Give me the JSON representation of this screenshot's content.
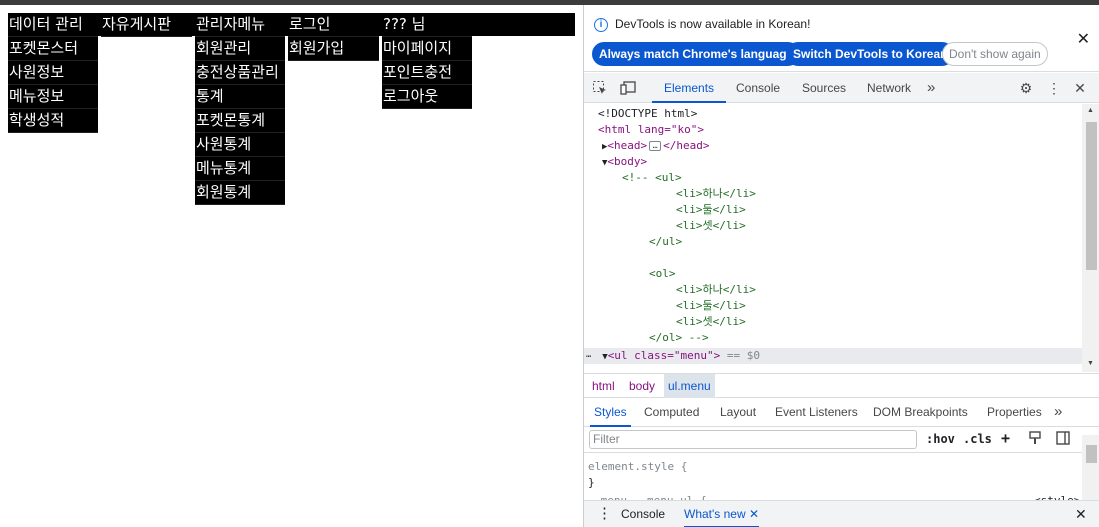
{
  "page": {
    "menu": [
      {
        "label": "데이터 관리",
        "items": [
          "포켓몬스터",
          "사원정보",
          "메뉴정보",
          "학생성적"
        ]
      },
      {
        "label": "자유게시판",
        "items": []
      },
      {
        "label": "관리자메뉴",
        "items": [
          "회원관리",
          "충전상품관리",
          "통계",
          "포켓몬통계",
          "사원통계",
          "메뉴통계",
          "회원통계"
        ]
      },
      {
        "label": "로그인",
        "items": [
          "회원가입"
        ]
      },
      {
        "label": "??? 님",
        "items": [
          "마이페이지",
          "포인트충전",
          "로그아웃"
        ]
      }
    ]
  },
  "devtools": {
    "info": {
      "icon": "info-icon",
      "message": "DevTools is now available in Korean!",
      "btn_match": "Always match Chrome's language",
      "btn_switch": "Switch DevTools to Korean",
      "btn_dont": "Don't show again",
      "close": "✕"
    },
    "tabs": {
      "elements": "Elements",
      "console": "Console",
      "sources": "Sources",
      "network": "Network",
      "more": "»"
    },
    "dom": [
      "<!DOCTYPE html>",
      "<html lang=\"ko\">",
      "<head>",
      "</head>",
      "<body>",
      "<!-- <ul>",
      "<li>하나</li>",
      "<li>둘</li>",
      "<li>셋</li>",
      "</ul>",
      "<ol>",
      "<li>하나</li>",
      "<li>둘</li>",
      "<li>셋</li>",
      "</ol> -->",
      "<ul class=\"menu\">",
      "== $0"
    ],
    "breadcrumbs": [
      "html",
      "body",
      "ul.menu"
    ],
    "subtabs": {
      "styles": "Styles",
      "computed": "Computed",
      "layout": "Layout",
      "event_listeners": "Event Listeners",
      "dom_breakpoints": "DOM Breakpoints",
      "properties": "Properties",
      "more": "»"
    },
    "filter_placeholder": "Filter",
    "tools": {
      "hov": ":hov",
      "cls": ".cls",
      "plus": "+"
    },
    "styles": {
      "element_style": "element.style {",
      "close_brace": "}",
      "rule": ".menu, .menu ul {",
      "source": "<style>"
    },
    "drawer": {
      "console": "Console",
      "whats_new": "What's new",
      "close_tab": "✕",
      "close": "✕"
    }
  }
}
